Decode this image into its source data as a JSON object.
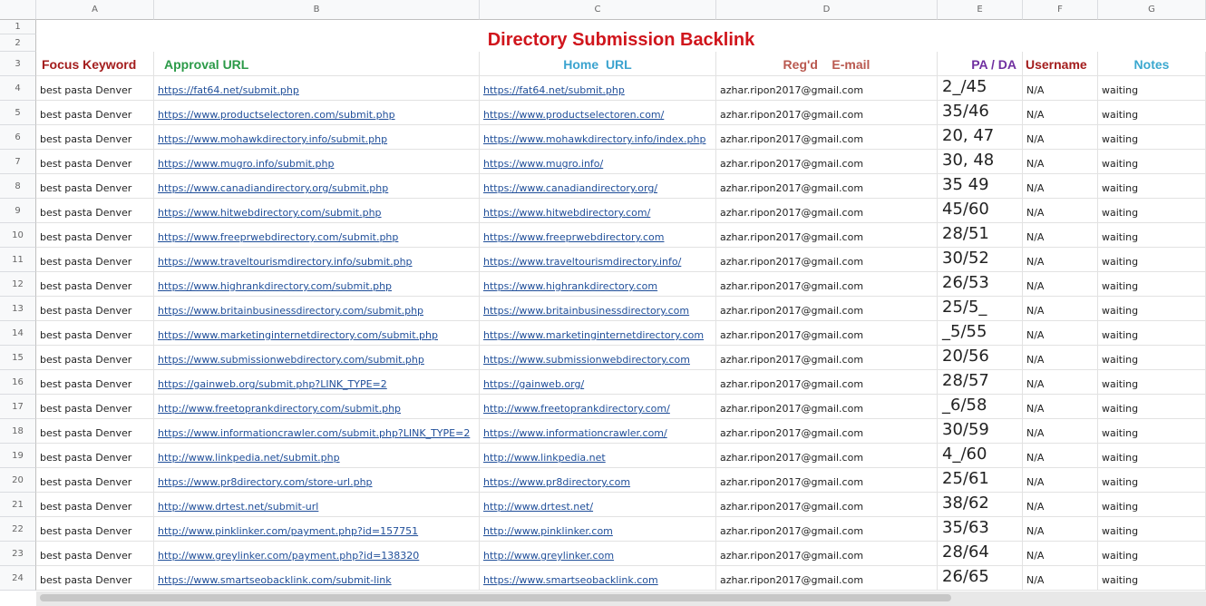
{
  "columns": [
    "A",
    "B",
    "C",
    "D",
    "E",
    "F",
    "G"
  ],
  "title": "Directory Submission Backlink",
  "headers": {
    "focus_keyword": "Focus Keyword",
    "approval_url": "Approval URL",
    "home_url": "Home  URL",
    "email": "Reg'd    E-mail",
    "pa_da": "PA / DA",
    "username": "Username",
    "notes": "Notes"
  },
  "colors": {
    "title": "#d0151c",
    "focus_keyword": "#a31c1c",
    "approval_url": "#2b9a48",
    "home_url": "#3ba3cf",
    "email": "#b9584f",
    "pa_da": "#7030a0",
    "username": "#a31c1c",
    "notes": "#3ba8cf",
    "link": "#1f4e99"
  },
  "rows": [
    {
      "n": "4",
      "kw": "best pasta Denver",
      "approval": "https://fat64.net/submit.php",
      "home": "https://fat64.net/submit.php",
      "email": "azhar.ripon2017@gmail.com",
      "pada": "2_/45",
      "user": "N/A",
      "notes": "waiting"
    },
    {
      "n": "5",
      "kw": "best pasta Denver",
      "approval": "https://www.productselectoren.com/submit.php",
      "home": "https://www.productselectoren.com/",
      "email": "azhar.ripon2017@gmail.com",
      "pada": "35/46",
      "user": "N/A",
      "notes": "waiting"
    },
    {
      "n": "6",
      "kw": "best pasta Denver",
      "approval": "https://www.mohawkdirectory.info/submit.php",
      "home": "https://www.mohawkdirectory.info/index.php",
      "email": "azhar.ripon2017@gmail.com",
      "pada": "20, 47",
      "user": "N/A",
      "notes": "waiting"
    },
    {
      "n": "7",
      "kw": "best pasta Denver",
      "approval": "https://www.mugro.info/submit.php",
      "home": "https://www.mugro.info/",
      "email": "azhar.ripon2017@gmail.com",
      "pada": "30, 48",
      "user": "N/A",
      "notes": "waiting"
    },
    {
      "n": "8",
      "kw": "best pasta Denver",
      "approval": "https://www.canadiandirectory.org/submit.php",
      "home": "https://www.canadiandirectory.org/",
      "email": "azhar.ripon2017@gmail.com",
      "pada": "35 49",
      "user": "N/A",
      "notes": "waiting"
    },
    {
      "n": "9",
      "kw": "best pasta Denver",
      "approval": "https://www.hitwebdirectory.com/submit.php",
      "home": "https://www.hitwebdirectory.com/",
      "email": "azhar.ripon2017@gmail.com",
      "pada": "45/60",
      "user": "N/A",
      "notes": "waiting"
    },
    {
      "n": "10",
      "kw": "best pasta Denver",
      "approval": "https://www.freeprwebdirectory.com/submit.php",
      "home": "https://www.freeprwebdirectory.com",
      "email": "azhar.ripon2017@gmail.com",
      "pada": "28/51",
      "user": "N/A",
      "notes": "waiting"
    },
    {
      "n": "11",
      "kw": "best pasta Denver",
      "approval": "https://www.traveltourismdirectory.info/submit.php",
      "home": "https://www.traveltourismdirectory.info/",
      "email": "azhar.ripon2017@gmail.com",
      "pada": "30/52",
      "user": "N/A",
      "notes": "waiting"
    },
    {
      "n": "12",
      "kw": "best pasta Denver",
      "approval": "https://www.highrankdirectory.com/submit.php",
      "home": "https://www.highrankdirectory.com",
      "email": "azhar.ripon2017@gmail.com",
      "pada": "26/53",
      "user": "N/A",
      "notes": "waiting"
    },
    {
      "n": "13",
      "kw": "best pasta Denver",
      "approval": "https://www.britainbusinessdirectory.com/submit.php",
      "home": "https://www.britainbusinessdirectory.com",
      "email": "azhar.ripon2017@gmail.com",
      "pada": "25/5_",
      "user": "N/A",
      "notes": "waiting"
    },
    {
      "n": "14",
      "kw": "best pasta Denver",
      "approval": "https://www.marketinginternetdirectory.com/submit.php",
      "home": "https://www.marketinginternetdirectory.com",
      "email": "azhar.ripon2017@gmail.com",
      "pada": "_5/55",
      "user": "N/A",
      "notes": "waiting"
    },
    {
      "n": "15",
      "kw": "best pasta Denver",
      "approval": "https://www.submissionwebdirectory.com/submit.php",
      "home": "https://www.submissionwebdirectory.com",
      "email": "azhar.ripon2017@gmail.com",
      "pada": "20/56",
      "user": "N/A",
      "notes": "waiting"
    },
    {
      "n": "16",
      "kw": "best pasta Denver",
      "approval": "https://gainweb.org/submit.php?LINK_TYPE=2",
      "home": "https://gainweb.org/",
      "email": "azhar.ripon2017@gmail.com",
      "pada": "28/57",
      "user": "N/A",
      "notes": "waiting"
    },
    {
      "n": "17",
      "kw": "best pasta Denver",
      "approval": "http://www.freetoprankdirectory.com/submit.php",
      "home": "http://www.freetoprankdirectory.com/",
      "email": "azhar.ripon2017@gmail.com",
      "pada": "_6/58",
      "user": "N/A",
      "notes": "waiting"
    },
    {
      "n": "18",
      "kw": "best pasta Denver",
      "approval": "https://www.informationcrawler.com/submit.php?LINK_TYPE=2",
      "home": "https://www.informationcrawler.com/",
      "email": "azhar.ripon2017@gmail.com",
      "pada": "30/59",
      "user": "N/A",
      "notes": "waiting"
    },
    {
      "n": "19",
      "kw": "best pasta Denver",
      "approval": "http://www.linkpedia.net/submit.php",
      "home": "http://www.linkpedia.net",
      "email": "azhar.ripon2017@gmail.com",
      "pada": "4_/60",
      "user": "N/A",
      "notes": "waiting"
    },
    {
      "n": "20",
      "kw": "best pasta Denver",
      "approval": "https://www.pr8directory.com/store-url.php",
      "home": "https://www.pr8directory.com",
      "email": "azhar.ripon2017@gmail.com",
      "pada": "25/61",
      "user": "N/A",
      "notes": "waiting"
    },
    {
      "n": "21",
      "kw": "best pasta Denver",
      "approval": "http://www.drtest.net/submit-url",
      "home": "http://www.drtest.net/",
      "email": "azhar.ripon2017@gmail.com",
      "pada": "38/62",
      "user": "N/A",
      "notes": "waiting"
    },
    {
      "n": "22",
      "kw": "best pasta Denver",
      "approval": "http://www.pinklinker.com/payment.php?id=157751",
      "home": "http://www.pinklinker.com",
      "email": "azhar.ripon2017@gmail.com",
      "pada": "35/63",
      "user": "N/A",
      "notes": "waiting"
    },
    {
      "n": "23",
      "kw": "best pasta Denver",
      "approval": "http://www.greylinker.com/payment.php?id=138320",
      "home": "http://www.greylinker.com",
      "email": "azhar.ripon2017@gmail.com",
      "pada": "28/64",
      "user": "N/A",
      "notes": "waiting"
    },
    {
      "n": "24",
      "kw": "best pasta Denver",
      "approval": "https://www.smartseobacklink.com/submit-link",
      "home": "https://www.smartseobacklink.com",
      "email": "azhar.ripon2017@gmail.com",
      "pada": "26/65",
      "user": "N/A",
      "notes": "waiting"
    }
  ]
}
